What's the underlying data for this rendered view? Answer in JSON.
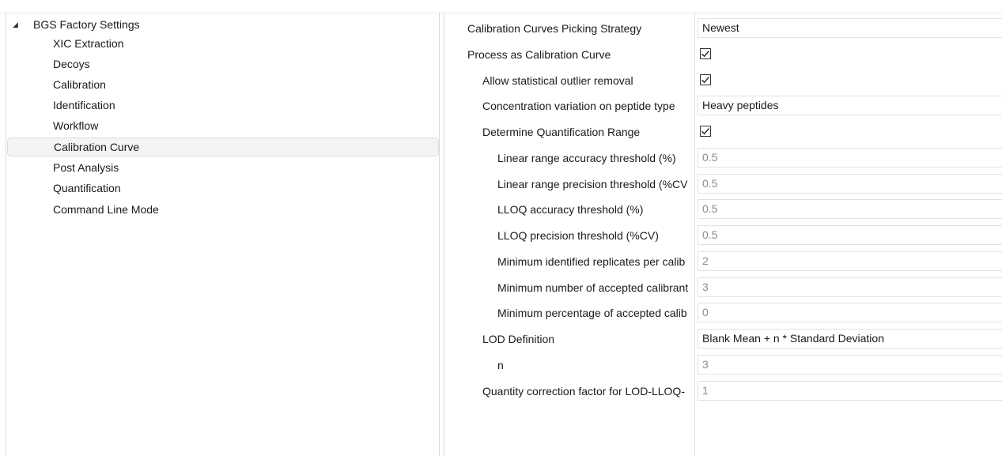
{
  "tree": {
    "root_label": "BGS Factory Settings",
    "items": [
      {
        "label": "XIC Extraction"
      },
      {
        "label": "Decoys"
      },
      {
        "label": "Calibration"
      },
      {
        "label": "Identification"
      },
      {
        "label": "Workflow"
      },
      {
        "label": "Calibration Curve",
        "selected": true
      },
      {
        "label": "Post Analysis"
      },
      {
        "label": "Quantification"
      },
      {
        "label": "Command Line Mode"
      }
    ]
  },
  "properties": [
    {
      "label": "Calibration Curves Picking Strategy",
      "value": "Newest",
      "type": "dropdown",
      "enabled": true
    },
    {
      "label": "Process as Calibration Curve",
      "checked": true,
      "type": "checkbox"
    },
    {
      "label": "Allow statistical outlier removal",
      "checked": true,
      "type": "checkbox"
    },
    {
      "label": "Concentration variation on peptide type",
      "value": "Heavy peptides",
      "type": "dropdown",
      "enabled": true
    },
    {
      "label": "Determine Quantification Range",
      "checked": true,
      "type": "checkbox"
    },
    {
      "label": "Linear range accuracy threshold (%)",
      "value": "0.5",
      "type": "text",
      "enabled": false
    },
    {
      "label": "Linear range precision threshold (%CV",
      "value": "0.5",
      "type": "text",
      "enabled": false
    },
    {
      "label": "LLOQ accuracy threshold (%)",
      "value": "0.5",
      "type": "text",
      "enabled": false
    },
    {
      "label": "LLOQ precision threshold (%CV)",
      "value": "0.5",
      "type": "text",
      "enabled": false
    },
    {
      "label": "Minimum identified replicates per calib",
      "value": "2",
      "type": "text",
      "enabled": false
    },
    {
      "label": "Minimum number of accepted calibrant",
      "value": "3",
      "type": "text",
      "enabled": false
    },
    {
      "label": "Minimum percentage of accepted calib",
      "value": "0",
      "type": "text",
      "enabled": false
    },
    {
      "label": "LOD Definition",
      "value": "Blank Mean + n * Standard Deviation",
      "type": "dropdown",
      "enabled": true
    },
    {
      "label": "n",
      "value": "3",
      "type": "text",
      "enabled": false
    },
    {
      "label": "Quantity correction factor for LOD-LLOQ-",
      "value": "1",
      "type": "text",
      "enabled": false
    }
  ],
  "icons": {
    "tree_toggle": "expanded-triangle-icon",
    "checkbox": "checkbox-checked-icon"
  }
}
